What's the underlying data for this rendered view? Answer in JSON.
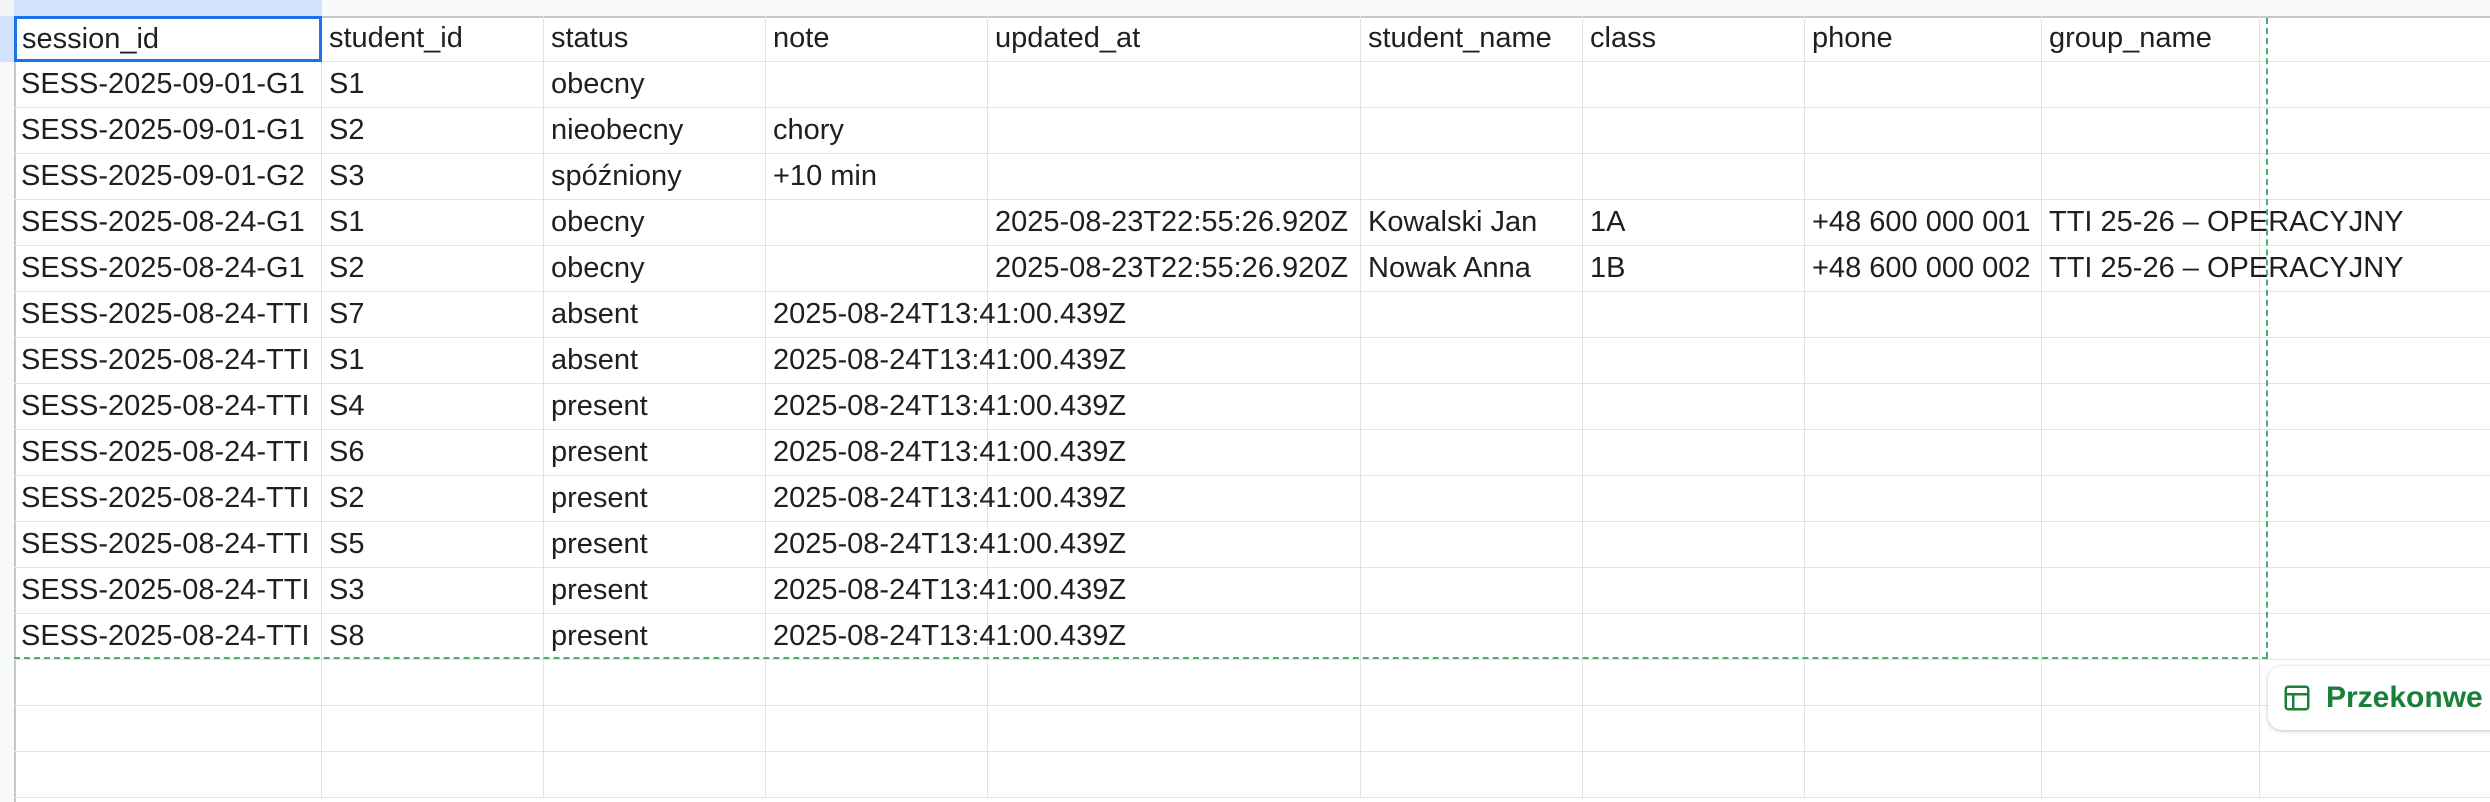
{
  "sheet": {
    "headers": [
      "session_id",
      "student_id",
      "status",
      "note",
      "updated_at",
      "student_name",
      "class",
      "phone",
      "group_name",
      ""
    ],
    "rows": [
      [
        "SESS-2025-09-01-G1",
        "S1",
        "obecny",
        "",
        "",
        "",
        "",
        "",
        "",
        ""
      ],
      [
        "SESS-2025-09-01-G1",
        "S2",
        "nieobecny",
        "chory",
        "",
        "",
        "",
        "",
        "",
        ""
      ],
      [
        "SESS-2025-09-01-G2",
        "S3",
        "spóźniony",
        "+10 min",
        "",
        "",
        "",
        "",
        "",
        ""
      ],
      [
        "SESS-2025-08-24-G1",
        "S1",
        "obecny",
        "",
        "2025-08-23T22:55:26.920Z",
        "Kowalski Jan",
        "1A",
        "+48 600 000 001",
        "TTI 25-26 – OPERACYJNY",
        ""
      ],
      [
        "SESS-2025-08-24-G1",
        "S2",
        "obecny",
        "",
        "2025-08-23T22:55:26.920Z",
        "Nowak Anna",
        "1B",
        "+48 600 000 002",
        "TTI 25-26 – OPERACYJNY",
        ""
      ],
      [
        "SESS-2025-08-24-TTI",
        "S7",
        "absent",
        "2025-08-24T13:41:00.439Z",
        "",
        "",
        "",
        "",
        "",
        ""
      ],
      [
        "SESS-2025-08-24-TTI",
        "S1",
        "absent",
        "2025-08-24T13:41:00.439Z",
        "",
        "",
        "",
        "",
        "",
        ""
      ],
      [
        "SESS-2025-08-24-TTI",
        "S4",
        "present",
        "2025-08-24T13:41:00.439Z",
        "",
        "",
        "",
        "",
        "",
        ""
      ],
      [
        "SESS-2025-08-24-TTI",
        "S6",
        "present",
        "2025-08-24T13:41:00.439Z",
        "",
        "",
        "",
        "",
        "",
        ""
      ],
      [
        "SESS-2025-08-24-TTI",
        "S2",
        "present",
        "2025-08-24T13:41:00.439Z",
        "",
        "",
        "",
        "",
        "",
        ""
      ],
      [
        "SESS-2025-08-24-TTI",
        "S5",
        "present",
        "2025-08-24T13:41:00.439Z",
        "",
        "",
        "",
        "",
        "",
        ""
      ],
      [
        "SESS-2025-08-24-TTI",
        "S3",
        "present",
        "2025-08-24T13:41:00.439Z",
        "",
        "",
        "",
        "",
        "",
        ""
      ],
      [
        "SESS-2025-08-24-TTI",
        "S8",
        "present",
        "2025-08-24T13:41:00.439Z",
        "",
        "",
        "",
        "",
        "",
        ""
      ],
      [
        "",
        "",
        "",
        "",
        "",
        "",
        "",
        "",
        "",
        ""
      ],
      [
        "",
        "",
        "",
        "",
        "",
        "",
        "",
        "",
        "",
        ""
      ],
      [
        "",
        "",
        "",
        "",
        "",
        "",
        "",
        "",
        "",
        ""
      ]
    ]
  },
  "convert_chip": {
    "label": "Przekonwe",
    "icon": "table-icon"
  },
  "colors": {
    "selection": "#1a73e8",
    "data_range_border": "#4caf70",
    "chip_text": "#188038"
  }
}
